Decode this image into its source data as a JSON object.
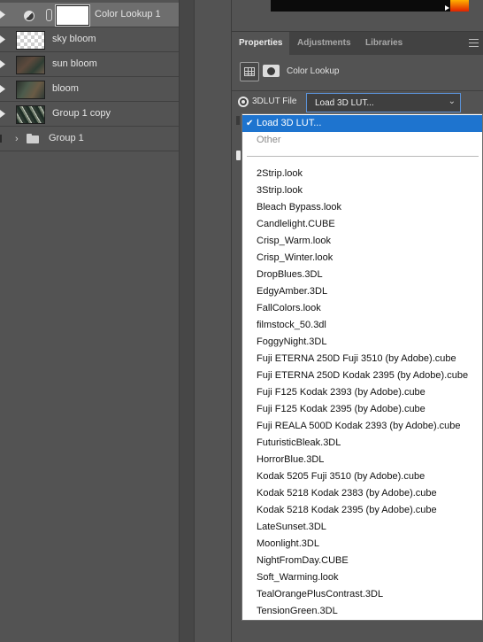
{
  "layers": [
    {
      "name": "Color Lookup 1",
      "kind": "adjustment",
      "selected": true
    },
    {
      "name": "sky bloom",
      "kind": "transparent"
    },
    {
      "name": "sun bloom",
      "kind": "photo"
    },
    {
      "name": "bloom",
      "kind": "photo"
    },
    {
      "name": "Group 1 copy",
      "kind": "photo"
    },
    {
      "name": "Group 1",
      "kind": "group"
    }
  ],
  "panel": {
    "tabs": [
      {
        "label": "Properties",
        "active": true
      },
      {
        "label": "Adjustments",
        "active": false
      },
      {
        "label": "Libraries",
        "active": false
      }
    ],
    "title": "Color Lookup",
    "lut_label": "3DLUT File",
    "lut_selected": "Load 3D LUT...",
    "icons": [
      "grid-icon",
      "mask-icon",
      "panel-menu-icon",
      "radio-icon",
      "chevron-down-icon"
    ]
  },
  "dropdown": {
    "top_items": [
      {
        "label": "Load 3D LUT...",
        "checked": true,
        "highlighted": true
      },
      {
        "label": "Other",
        "disabled": true
      }
    ],
    "files": [
      "2Strip.look",
      "3Strip.look",
      "Bleach Bypass.look",
      "Candlelight.CUBE",
      "Crisp_Warm.look",
      "Crisp_Winter.look",
      "DropBlues.3DL",
      "EdgyAmber.3DL",
      "FallColors.look",
      "filmstock_50.3dl",
      "FoggyNight.3DL",
      "Fuji ETERNA 250D Fuji 3510 (by Adobe).cube",
      "Fuji ETERNA 250D Kodak 2395 (by Adobe).cube",
      "Fuji F125 Kodak 2393 (by Adobe).cube",
      "Fuji F125 Kodak 2395 (by Adobe).cube",
      "Fuji REALA 500D Kodak 2393 (by Adobe).cube",
      "FuturisticBleak.3DL",
      "HorrorBlue.3DL",
      "Kodak 5205 Fuji 3510 (by Adobe).cube",
      "Kodak 5218 Kodak 2383 (by Adobe).cube",
      "Kodak 5218 Kodak 2395 (by Adobe).cube",
      "LateSunset.3DL",
      "Moonlight.3DL",
      "NightFromDay.CUBE",
      "Soft_Warming.look",
      "TealOrangePlusContrast.3DL",
      "TensionGreen.3DL"
    ]
  },
  "colors": {
    "highlight": "#1e74cf",
    "panel_bg": "#535353",
    "focus_border": "#5b92d8"
  }
}
